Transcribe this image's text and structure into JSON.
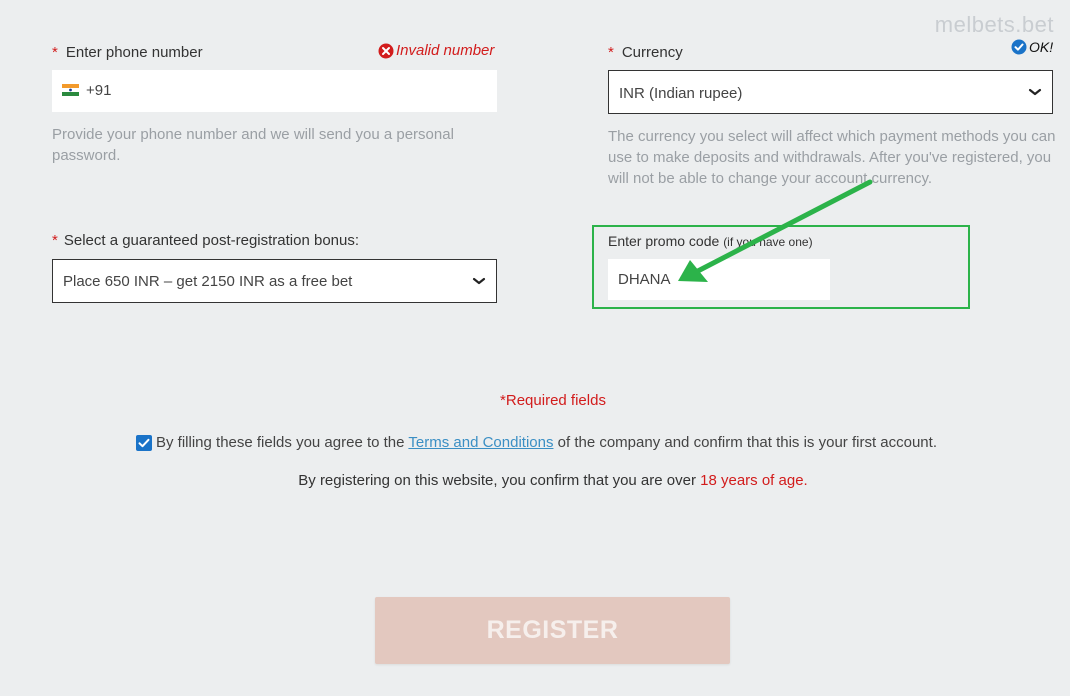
{
  "watermark": "melbets.bet",
  "phone": {
    "required_mark": "*",
    "label": "Enter phone number",
    "status": "Invalid number",
    "prefix": "+91",
    "hint": "Provide your phone number and we will send you a personal password."
  },
  "currency": {
    "required_mark": "*",
    "label": "Currency",
    "status": "OK!",
    "selected": "INR (Indian rupee)",
    "hint": "The currency you select will affect which payment methods you can use to make deposits and withdrawals. After you've registered, you will not be able to change your account currency."
  },
  "bonus": {
    "required_mark": "*",
    "label": "Select a guaranteed post-registration bonus:",
    "selected": "Place 650 INR – get 2150 INR as a free bet"
  },
  "promo": {
    "label": "Enter promo code",
    "label_note": "(if you have one)",
    "value": "DHANA",
    "highlight_color": "#2cb34a"
  },
  "footer": {
    "required_fields": "*Required fields",
    "agree_prefix": "By filling these fields you agree to the",
    "terms_link": "Terms and Conditions",
    "agree_suffix": "of the company and confirm that this is your first account.",
    "age_prefix": "By registering on this website, you confirm that you are over",
    "age_value": "18 years of age."
  },
  "register_label": "REGISTER",
  "colors": {
    "required_red": "#d21c1c",
    "ok_blue": "#1a73c8",
    "link_blue": "#3b8fc4",
    "checkbox_blue": "#1a73c8",
    "register_bg": "#e3c8bf"
  }
}
